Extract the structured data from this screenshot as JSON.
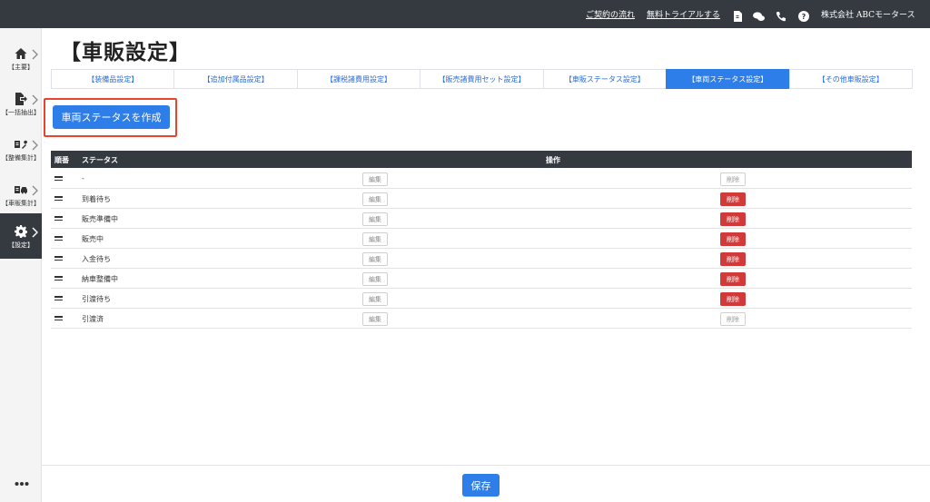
{
  "header": {
    "contract_flow_link": "ご契約の流れ",
    "free_trial_link": "無料トライアルする",
    "company_name": "株式会社 ABCモータース"
  },
  "sidebar": {
    "items": [
      {
        "label": "【主要】",
        "icon": "home-icon"
      },
      {
        "label": "【一括抽出】",
        "icon": "file-export-icon"
      },
      {
        "label": "【整備集計】",
        "icon": "repair-icon"
      },
      {
        "label": "【車販集計】",
        "icon": "car-icon"
      },
      {
        "label": "【設定】",
        "icon": "gear-icon",
        "active": true
      }
    ]
  },
  "page": {
    "title": "【車販設定】"
  },
  "tabs": [
    {
      "label": "【装備品設定】"
    },
    {
      "label": "【追加付属品設定】"
    },
    {
      "label": "【課税諸費用設定】"
    },
    {
      "label": "【販売諸費用セット設定】"
    },
    {
      "label": "【車販ステータス設定】"
    },
    {
      "label": "【車両ステータス設定】",
      "active": true
    },
    {
      "label": "【その他車販設定】"
    }
  ],
  "create_button_label": "車両ステータスを作成",
  "table": {
    "headers": {
      "order": "順番",
      "status": "ステータス",
      "operation": "操作"
    },
    "edit_label": "編集",
    "delete_label": "削除",
    "rows": [
      {
        "status": "-",
        "delete_enabled": false
      },
      {
        "status": "到着待ち",
        "delete_enabled": true
      },
      {
        "status": "販売準備中",
        "delete_enabled": true
      },
      {
        "status": "販売中",
        "delete_enabled": true
      },
      {
        "status": "入金待ち",
        "delete_enabled": true
      },
      {
        "status": "納車整備中",
        "delete_enabled": true
      },
      {
        "status": "引渡待ち",
        "delete_enabled": true
      },
      {
        "status": "引渡済",
        "delete_enabled": false
      }
    ]
  },
  "footer": {
    "save_label": "保存"
  },
  "colors": {
    "topbar": "#343a40",
    "primary": "#2d7ee8",
    "danger": "#d23a3a",
    "highlight_border": "#e8452c"
  }
}
